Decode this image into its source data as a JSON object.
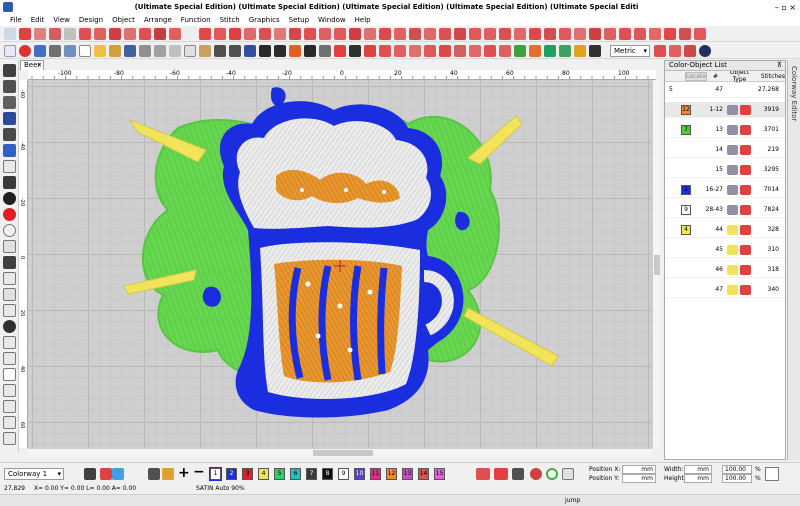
{
  "window": {
    "title": "(Ultimate Special Edition) (Ultimate Special Edition) (Ultimate Special Edition) (Ultimate Special Edition) (Ultimate Special Editi",
    "controls": "– ▫ ×"
  },
  "menu": [
    "File",
    "Edit",
    "View",
    "Design",
    "Object",
    "Arrange",
    "Function",
    "Stitch",
    "Graphics",
    "Setup",
    "Window",
    "Help"
  ],
  "toolbar": {
    "units": "Metric"
  },
  "document": {
    "tab_label": "Beer",
    "ruler_h": [
      "-100",
      "-80",
      "-60",
      "-40",
      "-20",
      "0",
      "20",
      "40",
      "60",
      "80",
      "100"
    ],
    "ruler_v": [
      "-60",
      "-40",
      "-20",
      "0",
      "20",
      "40",
      "60"
    ]
  },
  "color_object_list": {
    "title": "Color-Object List",
    "header": {
      "locate": "Locate",
      "num": "#",
      "object_type": "Object Type",
      "stitches": "Stitches"
    },
    "rows": [
      {
        "index": "5",
        "num": "47",
        "stitches": "27,268",
        "color": "",
        "icon1": "",
        "icon2": ""
      },
      {
        "index": "12",
        "num": "1-12",
        "stitches": "3919",
        "color": "#f08a24",
        "icon1": "group-icon",
        "icon2": "satin-icon"
      },
      {
        "index": "7",
        "num": "13",
        "stitches": "3701",
        "color": "#58c83a",
        "icon1": "fill-icon",
        "icon2": "satin-icon"
      },
      {
        "index": "",
        "num": "14",
        "stitches": "219",
        "color": "",
        "icon1": "fill-icon",
        "icon2": "satin-icon"
      },
      {
        "index": "",
        "num": "15",
        "stitches": "3295",
        "color": "",
        "icon1": "fill-icon",
        "icon2": "satin-icon"
      },
      {
        "index": "2",
        "num": "16-27",
        "stitches": "7014",
        "color": "#1a2ee0",
        "icon1": "group-icon",
        "icon2": "satin-icon"
      },
      {
        "index": "9",
        "num": "28-43",
        "stitches": "7824",
        "color": "#ffffff",
        "icon1": "group-icon",
        "icon2": "satin-icon"
      },
      {
        "index": "4",
        "num": "44",
        "stitches": "328",
        "color": "#f2e45a",
        "icon1": "line-icon",
        "icon2": "run-icon"
      },
      {
        "index": "",
        "num": "45",
        "stitches": "310",
        "color": "",
        "icon1": "line-icon",
        "icon2": "run-icon"
      },
      {
        "index": "",
        "num": "46",
        "stitches": "318",
        "color": "",
        "icon1": "line-icon",
        "icon2": "run-icon"
      },
      {
        "index": "",
        "num": "47",
        "stitches": "340",
        "color": "",
        "icon1": "line-icon",
        "icon2": "run-icon"
      }
    ]
  },
  "side_tab": "Colorway Editor",
  "bottom": {
    "colorway": "Colorway 1",
    "swatches": [
      {
        "n": "1",
        "color": "#ffffff"
      },
      {
        "n": "2",
        "color": "#1a2ee0"
      },
      {
        "n": "3",
        "color": "#e02020"
      },
      {
        "n": "4",
        "color": "#f2e45a"
      },
      {
        "n": "5",
        "color": "#2ad06a"
      },
      {
        "n": "6",
        "color": "#20c0c0"
      },
      {
        "n": "7",
        "color": "#3a3a3a"
      },
      {
        "n": "8",
        "color": "#111111"
      },
      {
        "n": "9",
        "color": "#ffffff"
      },
      {
        "n": "10",
        "color": "#5a40c0"
      },
      {
        "n": "11",
        "color": "#e02a8a"
      },
      {
        "n": "12",
        "color": "#f08a24"
      },
      {
        "n": "13",
        "color": "#c050c0"
      },
      {
        "n": "14",
        "color": "#d85050"
      },
      {
        "n": "15",
        "color": "#e060e0"
      }
    ],
    "position_x_label": "Position X:",
    "position_y_label": "Position Y:",
    "width_label": "Width:",
    "height_label": "Height:",
    "pos_x_value": "mm",
    "pos_y_value": "mm",
    "width_value": "mm",
    "height_value": "mm",
    "width_pct": "100.00",
    "height_pct": "100.00",
    "pct": "%"
  },
  "status": {
    "stitch_count": "27,829",
    "coords": "X= 0.00 Y= 0.00 L= 0.00 A= 0.00",
    "mode": "SATIN Auto 90%",
    "command": "jump"
  }
}
